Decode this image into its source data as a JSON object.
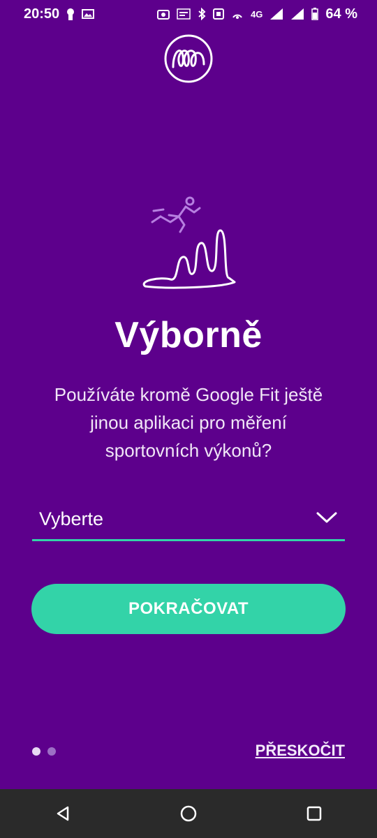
{
  "status_bar": {
    "time": "20:50",
    "network": "4G",
    "sim2": "2R",
    "battery": "64 %"
  },
  "colors": {
    "background": "#5d008c",
    "accent": "#33d3a8",
    "navbar": "#2a2a2a"
  },
  "icons": {
    "logo": "brand-logo-icon",
    "hero": "runner-chart-illustration",
    "select": "chevron-down-icon",
    "nav": [
      "back-icon",
      "home-icon",
      "recents-icon"
    ]
  },
  "main": {
    "title": "Výborně",
    "question": "Používáte kromě Google Fit ještě jinou aplikaci pro měření sportovních výkonů?",
    "select": {
      "value": "Vyberte"
    },
    "continue_label": "POKRAČOVAT"
  },
  "footer": {
    "skip_label": "PŘESKOČIT",
    "page_count": 2,
    "active_page": 1
  }
}
